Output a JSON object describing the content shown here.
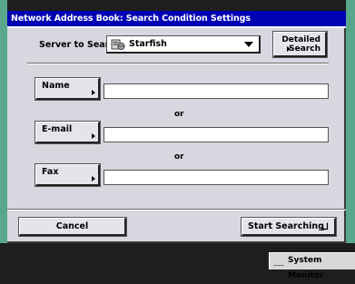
{
  "window": {
    "title": "Network Address Book: Search Condition Settings"
  },
  "server": {
    "label": "Server to Search:",
    "selected": "Starfish",
    "icon": "server-icon"
  },
  "detailed_search": {
    "line1": "Detailed",
    "line2": "Search"
  },
  "fields": {
    "name": {
      "label": "Name",
      "value": ""
    },
    "email": {
      "label": "E-mail",
      "value": ""
    },
    "fax": {
      "label": "Fax",
      "value": ""
    }
  },
  "separator": "or",
  "footer": {
    "cancel": "Cancel",
    "start": "Start Searching"
  },
  "status_bar": {
    "system_monitor": "System Monitor"
  },
  "colors": {
    "title_bar": "#0000b5",
    "background_strip": "#58a78c",
    "panel": "#d6d7df"
  }
}
